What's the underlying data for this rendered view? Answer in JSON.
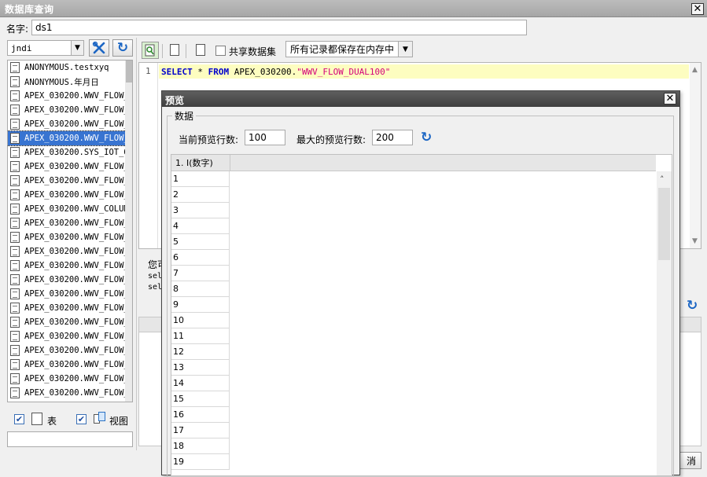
{
  "window": {
    "title": "数据库查询"
  },
  "name_field": {
    "label": "名字:",
    "value": "ds1"
  },
  "connection": {
    "value": "jndi"
  },
  "tree": {
    "items": [
      "ANONYMOUS.testxyq",
      "ANONYMOUS.年月日",
      "APEX_030200.WWV_FLOW_(",
      "APEX_030200.WWV_FLOW_.",
      "APEX_030200.WWV_FLOW_.",
      "APEX_030200.WWV_FLOW_1",
      "APEX_030200.SYS_IOT_O'",
      "APEX_030200.WWV_FLOW_(",
      "APEX_030200.WWV_FLOW_1",
      "APEX_030200.WWV_FLOW_1",
      "APEX_030200.WWV_COLUM",
      "APEX_030200.WWV_FLOW_(",
      "APEX_030200.WWV_FLOW_1",
      "APEX_030200.WWV_FLOW_1",
      "APEX_030200.WWV_FLOW_",
      "APEX_030200.WWV_FLOW_1",
      "APEX_030200.WWV_FLOW_1",
      "APEX_030200.WWV_FLOW_1",
      "APEX_030200.WWV_FLOW_1",
      "APEX_030200.WWV_FLOW_1",
      "APEX_030200.WWV_FLOW_1",
      "APEX_030200.WWV_FLOW_1",
      "APEX_030200.WWV_FLOW_(",
      "APEX_030200.WWV_FLOW_1",
      "APEX_030200.WWV FLOW :"
    ],
    "selected_index": 5
  },
  "filters": {
    "table_label": "表",
    "view_label": "视图"
  },
  "toolbar": {
    "shared_dataset_label": "共享数据集",
    "storage_mode": "所有记录都保存在内存中"
  },
  "editor": {
    "line_number": "1",
    "sql_keyword_select": "SELECT",
    "sql_star": " * ",
    "sql_keyword_from": "FROM",
    "sql_table": " APEX_030200.",
    "sql_string": "\"WWV_FLOW_DUAL100\""
  },
  "hidden_pane": {
    "text1": "您可",
    "text2": "sel",
    "text3": "sel",
    "cancel_fragment": "消"
  },
  "preview": {
    "title": "预览",
    "group_label": "数据",
    "current_rows_label": "当前预览行数:",
    "current_rows_value": "100",
    "max_rows_label": "最大的预览行数:",
    "max_rows_value": "200",
    "column_header": "1. I(数字)",
    "rows": [
      "1",
      "2",
      "3",
      "4",
      "5",
      "6",
      "7",
      "8",
      "9",
      "10",
      "11",
      "12",
      "13",
      "14",
      "15",
      "16",
      "17",
      "18",
      "19"
    ]
  },
  "colors": {
    "selection": "#3874d1",
    "sql_highlight": "#fdfdc0",
    "keyword": "#0000cc",
    "string": "#d4007a"
  }
}
